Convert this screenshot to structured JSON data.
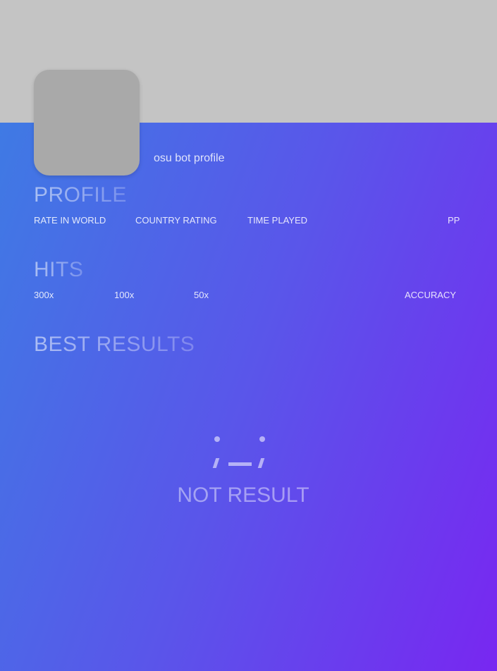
{
  "profile_header": {
    "username": "osu bot profile"
  },
  "profile": {
    "title": "PROFILE",
    "stats": [
      "RATE IN WORLD",
      "COUNTRY RATING",
      "TIME PLAYED",
      "PP"
    ]
  },
  "hits": {
    "title": "HITS",
    "stats": [
      "300x",
      "100x",
      "50x",
      "ACCURACY"
    ]
  },
  "best_results": {
    "title": "BEST RESULTS",
    "empty_text": "NOT RESULT",
    "empty_icon": "sad-face-icon"
  },
  "colors": {
    "banner": "#c4c4c4",
    "gradient_start": "#3f7ae4",
    "gradient_end": "#7827f1",
    "avatar": "#a9a9a9"
  }
}
